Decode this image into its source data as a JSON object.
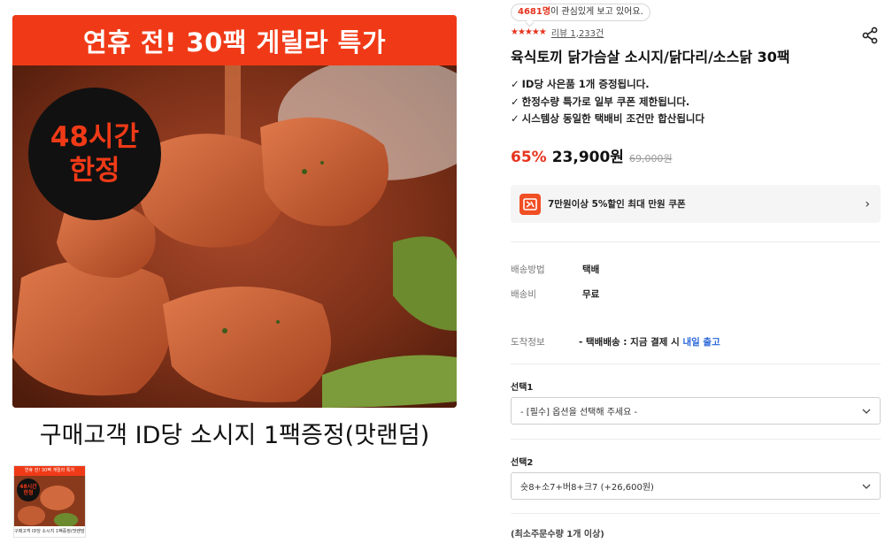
{
  "gallery": {
    "banner_text": "연휴 전! 30팩 게릴라 특가",
    "badge_line1": "48시간",
    "badge_line2": "한정",
    "caption": "구매고객 ID당 소시지 1팩증정(맛랜덤)",
    "thumb_banner": "연휴 전! 30팩 게릴라 특가",
    "thumb_badge_line1": "48시간",
    "thumb_badge_line2": "한정",
    "thumb_caption": "구매고객 ID당 소시지 1팩증정(맛랜덤)"
  },
  "product": {
    "interest_count": "4681명",
    "interest_suffix": "이 관심있게 보고 있어요.",
    "stars": "★★★★★",
    "review_text": "리뷰 1,233건",
    "title": "육식토끼 닭가슴살 소시지/닭다리/소스닭 30팩",
    "notes": [
      "ID당 사은품 1개 증정됩니다.",
      "한정수량 특가로 일부 쿠폰 제한됩니다.",
      "시스템상 동일한 택배비 조건만 합산됩니다"
    ],
    "check_mark": "✓",
    "discount": "65%",
    "price": "23,900원",
    "original_price": "69,000원"
  },
  "coupon": {
    "text": "7만원이상 5%할인 최대 만원 쿠폰",
    "chevron": "›"
  },
  "shipping": {
    "method_label": "배송방법",
    "method_value": "택배",
    "fee_label": "배송비",
    "fee_value": "무료",
    "arrival_label": "도착정보",
    "arrival_value_prefix": "- 택배배송 : 지금 결제 시 ",
    "arrival_value_highlight": "내일 출고"
  },
  "options": {
    "select1_label": "선택1",
    "select1_value": "- [필수] 옵션을 선택해 주세요 -",
    "select2_label": "선택2",
    "select2_value": "숏8+소7+버8+크7 (+26,600원)",
    "min_order": "(최소주문수량 1개 이상)"
  },
  "colors": {
    "accent_red": "#e6341e",
    "banner_red": "#f03a17",
    "link_blue": "#2a66d9"
  },
  "icons": {
    "share": "share-icon",
    "coupon": "coupon-icon",
    "dropdown": "chevron-down-icon"
  }
}
